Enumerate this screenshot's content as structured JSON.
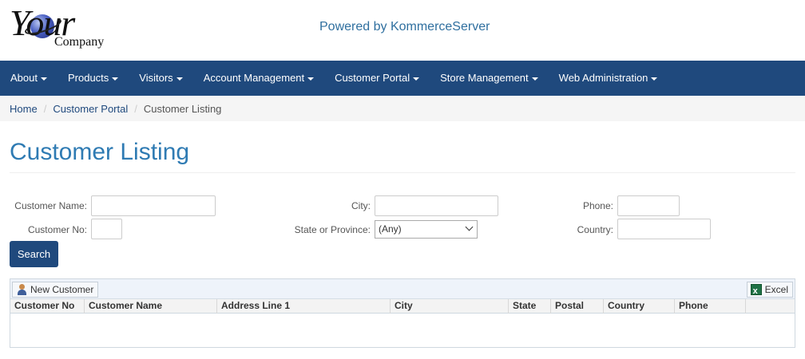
{
  "header": {
    "logo_word": "Your",
    "logo_sub": "Company",
    "powered_by": "Powered by KommerceServer"
  },
  "nav": [
    "About",
    "Products",
    "Visitors",
    "Account Management",
    "Customer Portal",
    "Store Management",
    "Web Administration"
  ],
  "breadcrumb": {
    "home": "Home",
    "portal": "Customer Portal",
    "current": "Customer Listing",
    "separator": "/"
  },
  "page_title": "Customer Listing",
  "form": {
    "customer_name_label": "Customer Name:",
    "customer_name_value": "",
    "city_label": "City:",
    "city_value": "",
    "phone_label": "Phone:",
    "phone_value": "",
    "customer_no_label": "Customer No:",
    "customer_no_value": "",
    "state_label": "State or Province:",
    "state_selected": "(Any)",
    "country_label": "Country:",
    "country_value": "",
    "search_label": "Search"
  },
  "grid": {
    "new_customer_label": "New Customer",
    "excel_label": "Excel",
    "columns": [
      "Customer No",
      "Customer Name",
      "Address Line 1",
      "City",
      "State",
      "Postal",
      "Country",
      "Phone"
    ]
  },
  "colors": {
    "navbar": "#1f497d",
    "title": "#2f7bb3",
    "link": "#1f497d"
  }
}
